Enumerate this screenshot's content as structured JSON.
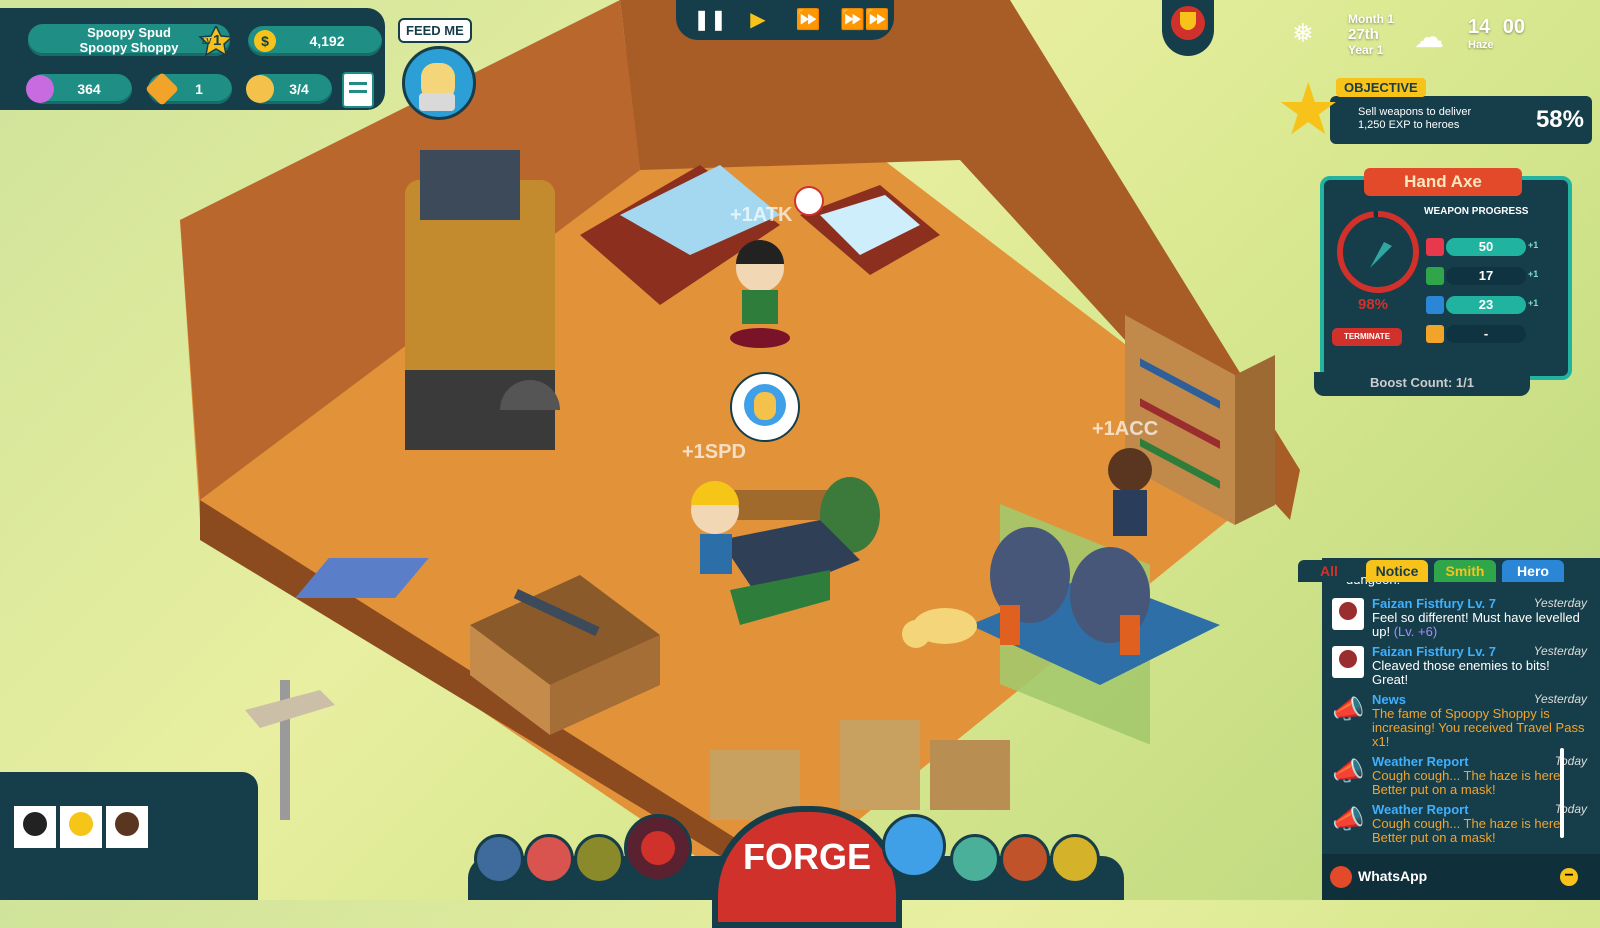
{
  "player": {
    "name": "Spoopy Spud",
    "shop": "Spoopy Shoppy",
    "level_prefix": "LV",
    "level": "1"
  },
  "resources": {
    "gold": "4,192",
    "hearts": "364",
    "tickets": "1",
    "workers": "3/4"
  },
  "feed": {
    "label": "FEED ME"
  },
  "calendar": {
    "month": "Month 1",
    "day": "27th",
    "year": "Year 1",
    "time_h": "14",
    "time_m": "00",
    "weather": "Haze"
  },
  "objective": {
    "title": "OBJECTIVE",
    "text_line1": "Sell weapons to deliver",
    "text_line2": "1,250 EXP to heroes",
    "percent": "58%"
  },
  "weapon": {
    "name": "Hand Axe",
    "progress_title": "WEAPON PROGRESS",
    "progress_pct": "98%",
    "terminate": "TERMINATE",
    "stats": [
      {
        "icon": "attack-icon",
        "value": "50",
        "bonus": "+1",
        "color": "#e8384b"
      },
      {
        "icon": "speed-icon",
        "value": "17",
        "bonus": "+1",
        "color": "#2fa64a"
      },
      {
        "icon": "accuracy-icon",
        "value": "23",
        "bonus": "+1",
        "color": "#2b86d6"
      },
      {
        "icon": "magic-icon",
        "value": "-",
        "bonus": "",
        "color": "#f2a42a"
      }
    ],
    "boost": "Boost Count: 1/1"
  },
  "floating_text": {
    "atk": "+1ATK",
    "spd": "+1SPD",
    "acc": "+1ACC"
  },
  "chat": {
    "tabs": [
      "All",
      "Notice",
      "Smith",
      "Hero"
    ],
    "partial": "dungeon!",
    "messages": [
      {
        "name": "Faizan Fistfury Lv. 7",
        "time": "Yesterday",
        "text": "Feel so different! Must have levelled up!",
        "extra": "(Lv. +6)"
      },
      {
        "name": "Faizan Fistfury Lv. 7",
        "time": "Yesterday",
        "text": "Cleaved those enemies to bits! Great!",
        "extra": ""
      },
      {
        "name": "News",
        "time": "Yesterday",
        "text": "The fame of Spoopy Shoppy is increasing! You received Travel Pass x1!",
        "extra": ""
      },
      {
        "name": "Weather Report",
        "time": "Today",
        "text": "Cough cough... The haze is here. Better put on a mask!",
        "extra": ""
      },
      {
        "name": "Weather Report",
        "time": "Today",
        "text": "Cough cough... The haze is here. Better put on a mask!",
        "extra": ""
      }
    ],
    "footer": "WhatsApp"
  },
  "forge": {
    "label": "FORGE"
  },
  "colors": {
    "panel": "#163d4a",
    "teal": "#1f8f86",
    "accent": "#d0322b",
    "gold": "#f7c31a"
  }
}
